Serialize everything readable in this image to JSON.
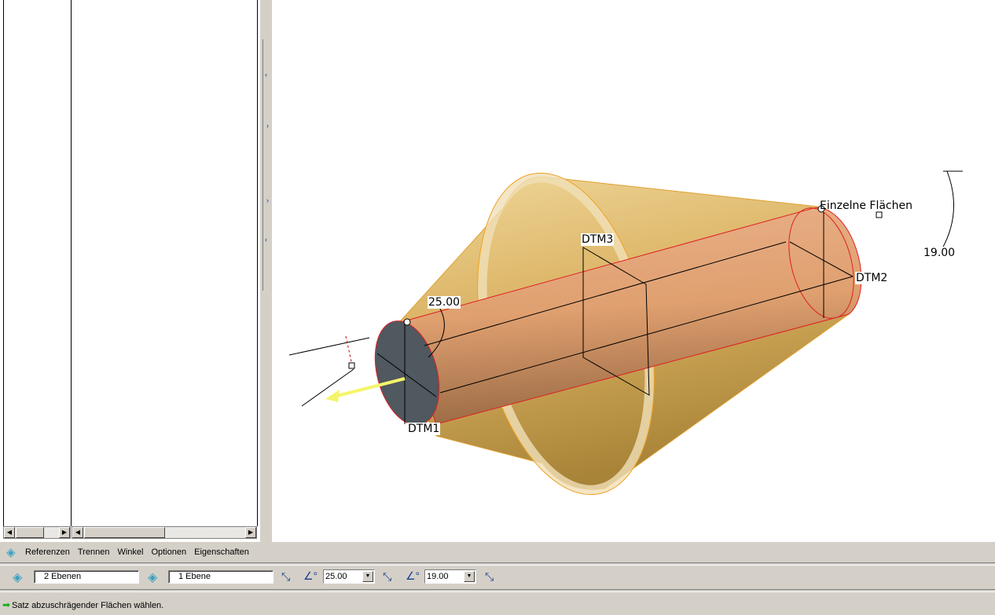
{
  "tabs": [
    "Referenzen",
    "Trennen",
    "Winkel",
    "Optionen",
    "Eigenschaften"
  ],
  "dashboard": {
    "ref1_value": "2 Ebenen",
    "ref2_value": "1 Ebene",
    "angle1_value": "25.00",
    "angle2_value": "19.00"
  },
  "status": "Satz abzuschrägender Flächen wählen.",
  "model": {
    "labels": {
      "dtm1": "DTM1",
      "dtm2": "DTM2",
      "dtm3": "DTM3",
      "angle1": "25.00",
      "angle2": "19.00",
      "single_faces": "Einzelne Flächen"
    }
  },
  "colors": {
    "cone": "#d4a850",
    "cylinder": "#e3a070",
    "edge": "#e02020",
    "arrow": "#f5f56a"
  }
}
